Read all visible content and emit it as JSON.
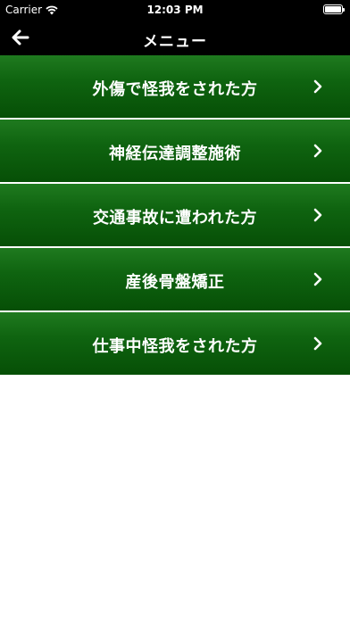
{
  "status_bar": {
    "carrier": "Carrier",
    "time": "12:03 PM",
    "battery_level": 1.0
  },
  "nav": {
    "title": "メニュー",
    "back_icon": "arrow-left-icon"
  },
  "menu": {
    "items": [
      {
        "label": "外傷で怪我をされた方"
      },
      {
        "label": "神経伝達調整施術"
      },
      {
        "label": "交通事故に遭われた方"
      },
      {
        "label": "産後骨盤矯正"
      },
      {
        "label": "仕事中怪我をされた方"
      }
    ],
    "chevron_icon": "chevron-right-icon"
  },
  "colors": {
    "bar_background": "#000000",
    "item_gradient_top": "#1f7a1f",
    "item_gradient_bottom": "#064f06",
    "text": "#ffffff",
    "page_background": "#ffffff"
  }
}
